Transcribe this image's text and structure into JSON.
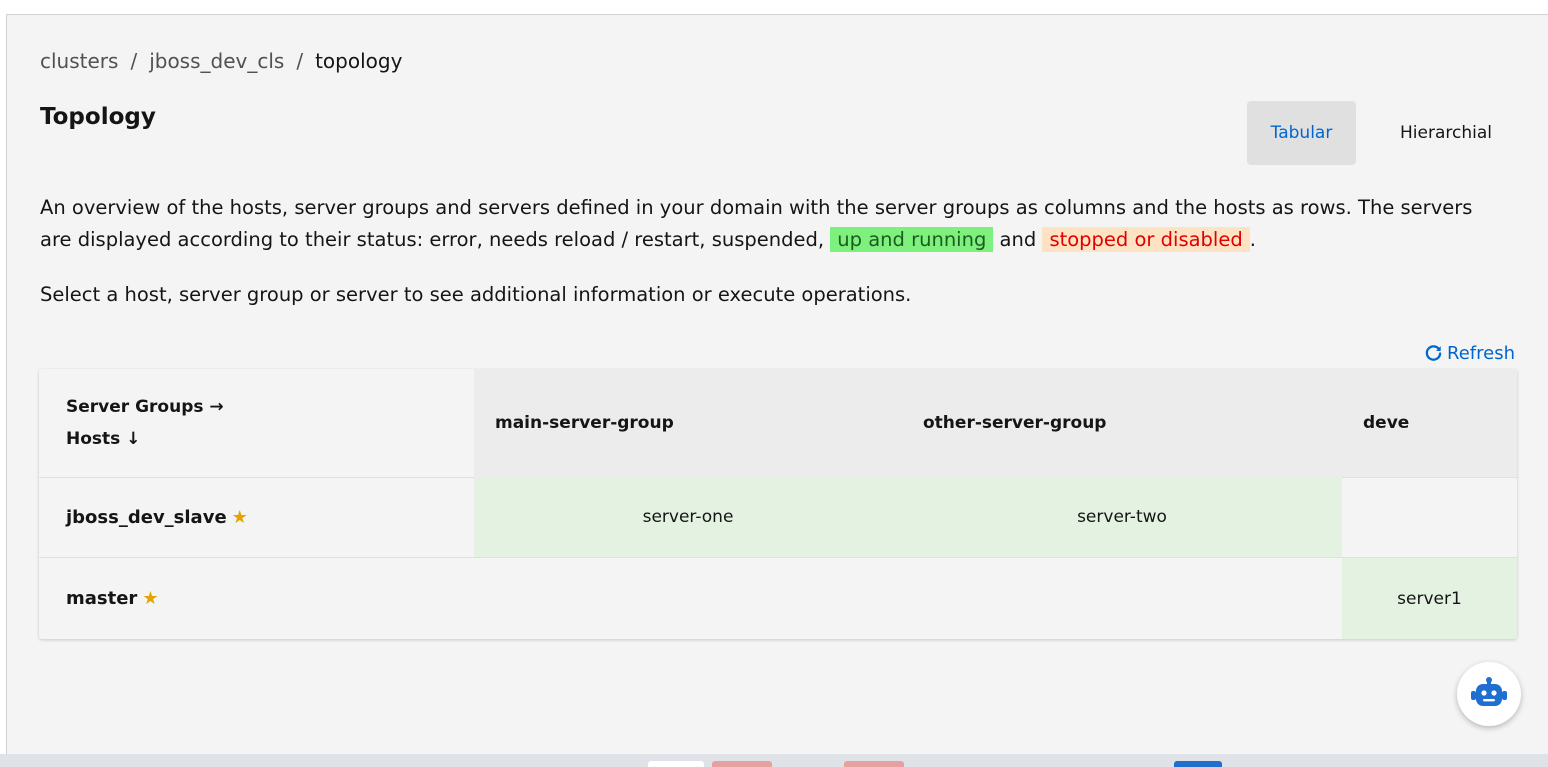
{
  "breadcrumb": {
    "items": [
      "clusters",
      "jboss_dev_cls",
      "topology"
    ],
    "separator": "/"
  },
  "page": {
    "title": "Topology"
  },
  "view_toggle": {
    "active": "Tabular",
    "inactive": "Hierarchial"
  },
  "description": {
    "line1_prefix": "An overview of the hosts, server groups and servers defined in your domain with the server groups as columns and the hosts as rows. The servers are displayed according to their status: error, needs reload / restart, suspended,",
    "running_label": "up and running",
    "connector": "and",
    "stopped_label": "stopped or disabled",
    "end": ".",
    "line2": "Select a host, server group or server to see additional information or execute operations."
  },
  "refresh": {
    "label": "Refresh",
    "icon": "refresh-icon"
  },
  "table": {
    "corner": {
      "groups_label": "Server Groups →",
      "hosts_label": "Hosts ↓"
    },
    "server_groups": [
      "main-server-group",
      "other-server-group",
      "deve"
    ],
    "hosts": [
      {
        "name": "jboss_dev_slave",
        "star": "★",
        "servers": [
          "server-one",
          "server-two",
          ""
        ]
      },
      {
        "name": "master",
        "star": "★",
        "servers": [
          "",
          "",
          "server1"
        ]
      }
    ]
  },
  "assistant": {
    "icon": "robot-icon"
  },
  "colors": {
    "accent": "#0066cc",
    "running_bg": "#7ef07e",
    "stopped_bg": "#fde2c4",
    "stopped_text": "#e00000",
    "server_running_cell": "#e4f2e2",
    "star": "#e3a400"
  }
}
